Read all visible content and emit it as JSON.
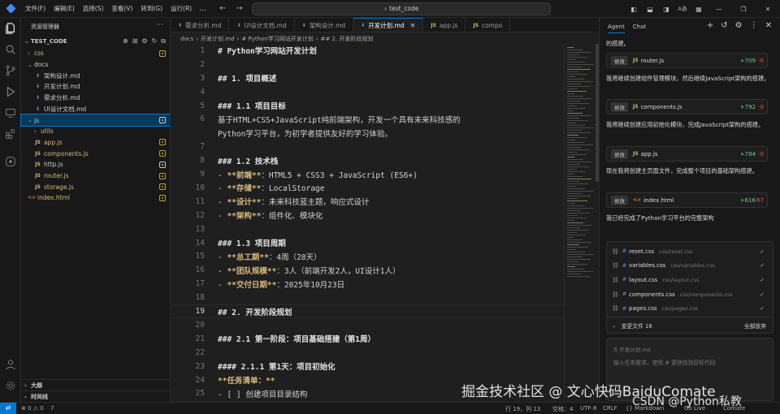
{
  "titlebar": {
    "menu": [
      "文件(F)",
      "编辑(E)",
      "选择(S)",
      "查看(V)",
      "转到(G)",
      "运行(R)"
    ],
    "more": "…",
    "back": "←",
    "forward": "→",
    "search_placeholder": "test_code"
  },
  "sidebar": {
    "title": "资源管理器",
    "project": "TEST_CODE",
    "tree": [
      {
        "label": "css",
        "type": "folder",
        "collapsed": true,
        "indent": 1,
        "color": "#d7ba7d",
        "badge": "modified"
      },
      {
        "label": "docs",
        "type": "folder",
        "collapsed": false,
        "indent": 1,
        "color": "#ccc"
      },
      {
        "label": "架构设计.md",
        "type": "md",
        "indent": 2,
        "color": "#ccc"
      },
      {
        "label": "开发计划.md",
        "type": "md",
        "indent": 2,
        "color": "#ccc"
      },
      {
        "label": "需求分析.md",
        "type": "md",
        "indent": 2,
        "color": "#ccc"
      },
      {
        "label": "UI设计文档.md",
        "type": "md",
        "indent": 2,
        "color": "#ccc"
      },
      {
        "label": "js",
        "type": "folder",
        "collapsed": false,
        "indent": 1,
        "color": "#ccc",
        "badge": "white",
        "selected": true
      },
      {
        "label": "utils",
        "type": "folder",
        "collapsed": true,
        "indent": 2,
        "color": "#d7ba7d"
      },
      {
        "label": "app.js",
        "type": "js",
        "indent": 2,
        "color": "#d7ba7d",
        "badge": "modified"
      },
      {
        "label": "components.js",
        "type": "js",
        "indent": 2,
        "color": "#d7ba7d",
        "badge": "modified"
      },
      {
        "label": "http.js",
        "type": "js",
        "indent": 2,
        "color": "#ccc",
        "badge": "white"
      },
      {
        "label": "router.js",
        "type": "js",
        "indent": 2,
        "color": "#d7ba7d",
        "badge": "modified"
      },
      {
        "label": "storage.js",
        "type": "js",
        "indent": 2,
        "color": "#d7ba7d",
        "badge": "modified"
      },
      {
        "label": "index.html",
        "type": "html",
        "indent": 1,
        "color": "#d7ba7d",
        "badge": "modified"
      }
    ],
    "outline": "大纲",
    "timeline": "时间线"
  },
  "tabs": [
    {
      "label": "需求分析.md",
      "icon": "md"
    },
    {
      "label": "UI设计文档.md",
      "icon": "md"
    },
    {
      "label": "架构设计.md",
      "icon": "md"
    },
    {
      "label": "开发计划.md",
      "icon": "md",
      "active": true
    },
    {
      "label": "app.js",
      "icon": "js"
    },
    {
      "label": "compo",
      "icon": "js"
    }
  ],
  "breadcrumb": [
    "docs",
    "开发计划.md",
    "# Python学习网站开发计划",
    "## 2. 开发阶段规划"
  ],
  "code_lines": [
    {
      "n": "1",
      "text": "# Python学习网站开发计划",
      "style": "h"
    },
    {
      "n": "2",
      "text": ""
    },
    {
      "n": "3",
      "text": "## 1. 项目概述",
      "style": "h"
    },
    {
      "n": "4",
      "text": ""
    },
    {
      "n": "5",
      "text": "### 1.1 项目目标",
      "style": "h"
    },
    {
      "n": "6",
      "text": "基于HTML+CSS+JavaScript纯前端架构，开发一个具有未来科技感的"
    },
    {
      "n": "",
      "text": "Python学习平台，为初学者提供友好的学习体验。"
    },
    {
      "n": "7",
      "text": ""
    },
    {
      "n": "8",
      "text": "### 1.2 技术栈",
      "style": "h"
    },
    {
      "n": "9",
      "pre": "- ",
      "bold": "**前端**",
      "text": "：HTML5 + CSS3 + JavaScript (ES6+)"
    },
    {
      "n": "10",
      "pre": "- ",
      "bold": "**存储**",
      "text": "：LocalStorage"
    },
    {
      "n": "11",
      "pre": "- ",
      "bold": "**设计**",
      "text": "：未来科技蓝主题，响应式设计"
    },
    {
      "n": "12",
      "pre": "- ",
      "bold": "**架构**",
      "text": "：组件化、模块化"
    },
    {
      "n": "13",
      "text": ""
    },
    {
      "n": "14",
      "text": "### 1.3 项目周期",
      "style": "h"
    },
    {
      "n": "15",
      "pre": "- ",
      "bold": "**总工期**",
      "text": "：4周（28天）"
    },
    {
      "n": "16",
      "pre": "- ",
      "bold": "**团队规模**",
      "text": "：3人（前端开发2人，UI设计1人）"
    },
    {
      "n": "17",
      "pre": "- ",
      "bold": "**交付日期**",
      "text": "：2025年10月23日"
    },
    {
      "n": "18",
      "text": ""
    },
    {
      "n": "19",
      "text": "## 2. 开发阶段规划",
      "style": "h",
      "current": true
    },
    {
      "n": "20",
      "text": ""
    },
    {
      "n": "21",
      "text": "### 2.1 第一阶段：项目基础搭建（第1周）",
      "style": "h"
    },
    {
      "n": "22",
      "text": ""
    },
    {
      "n": "23",
      "text": "#### 2.1.1 第1天：项目初始化",
      "style": "h"
    },
    {
      "n": "24",
      "pre": "",
      "bold": "**任务清单：**",
      "text": ""
    },
    {
      "n": "25",
      "text": "- [ ] 创建项目目录结构"
    }
  ],
  "panel": {
    "tabs": [
      "Agent",
      "Chat"
    ],
    "messages": [
      "的搭建。",
      "我将继续创建组件管理模块，然后继续JavaScript架构的搭建。",
      "我将继续创建应用初始化模块，完成JavaScript架构的搭建。",
      "现在我将创建主页面文件，完成整个项目的基础架构搭建。",
      "我已经完成了Python学习平台的完整架构"
    ],
    "changes": [
      {
        "btn": "修改",
        "icon": "JS",
        "file": "router.js",
        "add": "+709",
        "del": "-0"
      },
      {
        "btn": "修改",
        "icon": "JS",
        "file": "components.js",
        "add": "+792",
        "del": "-0"
      },
      {
        "btn": "修改",
        "icon": "JS",
        "file": "app.js",
        "add": "+784",
        "del": "-0"
      },
      {
        "btn": "修改",
        "icon": "<>",
        "file": "index.html",
        "add": "+616",
        "del": "-67"
      }
    ],
    "files": [
      {
        "name": "reset.css",
        "path": "css/reset.css"
      },
      {
        "name": "variables.css",
        "path": "css/variables.css"
      },
      {
        "name": "layout.css",
        "path": "css/layout.css"
      },
      {
        "name": "components.css",
        "path": "css/components.css"
      },
      {
        "name": "pages.css",
        "path": "css/pages.css"
      }
    ],
    "files_footer": "变更文件 16",
    "discard_all": "全部放弃",
    "input_hint1": "开发计划.md",
    "input_placeholder": "输入任务需求，使用 # 更快找到目标代码"
  },
  "status": {
    "problems": "⊗ 0 ⚠ 0",
    "ports": "7",
    "position": "行 19，列 13",
    "spaces": "空格：4",
    "encoding": "UTF-8",
    "eol": "CRLF",
    "lang": "{} Markdown",
    "golive": "Go Live",
    "ext": "Comate"
  },
  "watermark": {
    "line1": "掘金技术社区 @ 文心快码BaiduComate",
    "line2": "CSDN @Python私教"
  },
  "colors": {
    "accent": "#0078d4",
    "modified": "#d7ba7d",
    "added": "#73c991",
    "deleted": "#f14c4c"
  }
}
